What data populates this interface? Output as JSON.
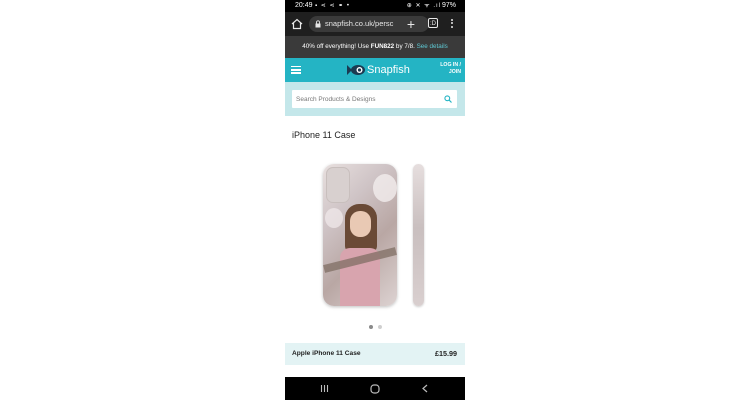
{
  "status_bar": {
    "time": "20:49",
    "left_icons": "▪ ⋖ ⋖ ⚭ •",
    "right_icons": "⊕ ✕ ᯤ .ıl",
    "battery": "97%"
  },
  "browser": {
    "url": "snapfish.co.uk/persc",
    "tab_count": ":D"
  },
  "promo": {
    "text_before": "40% off everything! Use ",
    "code": "FUN822",
    "text_after": " by 7/8. ",
    "link": "See details"
  },
  "header": {
    "brand": "Snapfish",
    "login_line1": "LOG IN /",
    "login_line2": "JOIN"
  },
  "search": {
    "placeholder": "Search Products & Designs"
  },
  "product": {
    "title": "iPhone 11 Case",
    "name": "Apple iPhone 11 Case",
    "price": "£15.99",
    "carousel_count": 2,
    "carousel_active": 1
  },
  "colors": {
    "nav_teal": "#24b4c4",
    "search_band": "#c4e7ea",
    "promo_bg": "#3a3a3a",
    "link": "#5fc9d4"
  },
  "icons": [
    "home-icon",
    "lock-icon",
    "plus-icon",
    "tabs-icon",
    "more-vert-icon",
    "hamburger-icon",
    "fish-logo-icon",
    "search-icon",
    "recents-icon",
    "android-home-icon",
    "back-icon"
  ]
}
